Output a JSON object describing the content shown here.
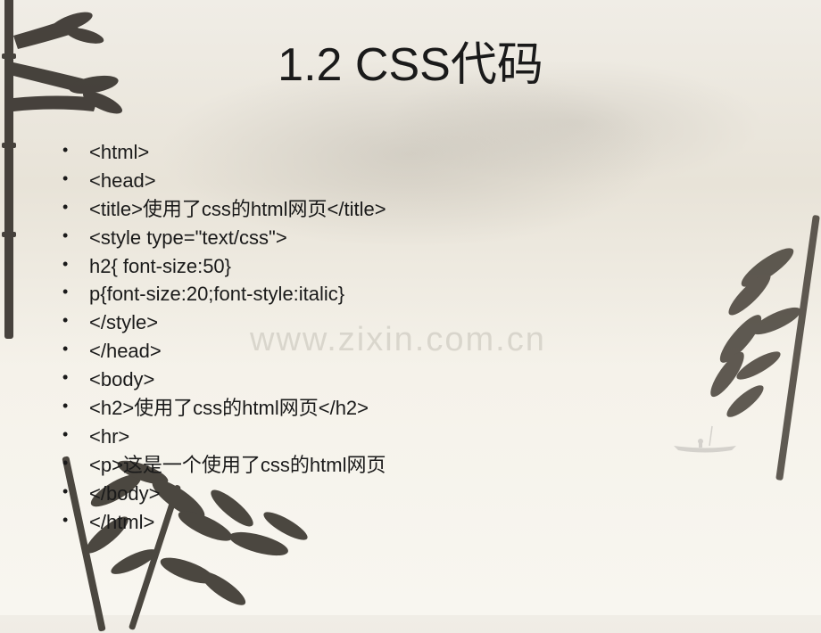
{
  "slide": {
    "title": "1.2 CSS代码",
    "watermark": "www.zixin.com.cn",
    "code_lines": [
      "<html>",
      "  <head>",
      "    <title>使用了css的html网页</title>",
      "  <style type=\"text/css\">",
      "  h2{ font-size:50}",
      "  p{font-size:20;font-style:italic}",
      "  </style>",
      "  </head>",
      "",
      "  <body>",
      "<h2>使用了css的html网页</h2>",
      "<hr>",
      "<p>这是一个使用了css的html网页",
      "  </body>",
      "</html>"
    ]
  }
}
